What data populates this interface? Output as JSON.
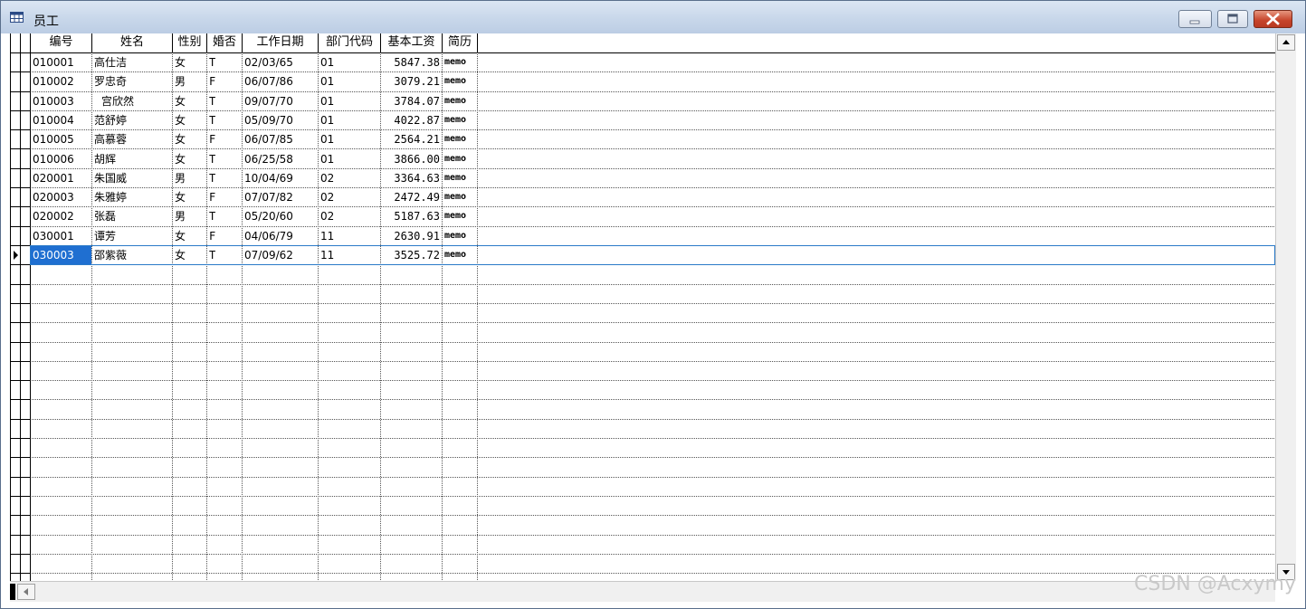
{
  "window": {
    "title": "员工",
    "title_icon": "table-icon",
    "controls": [
      "minimize-icon",
      "maximize-icon",
      "close-icon"
    ]
  },
  "table": {
    "columns": [
      "编号",
      "姓名",
      "性别",
      "婚否",
      "工作日期",
      "部门代码",
      "基本工资",
      "简历"
    ],
    "rows": [
      [
        "010001",
        "高仕洁",
        "女",
        "T",
        "02/03/65",
        "01",
        "5847.38",
        "memo"
      ],
      [
        "010002",
        "罗忠奇",
        "男",
        "F",
        "06/07/86",
        "01",
        "3079.21",
        "memo"
      ],
      [
        "010003",
        "宫欣然",
        "女",
        "T",
        "09/07/70",
        "01",
        "3784.07",
        "memo"
      ],
      [
        "010004",
        "范舒婷",
        "女",
        "T",
        "05/09/70",
        "01",
        "4022.87",
        "memo"
      ],
      [
        "010005",
        "高慕蓉",
        "女",
        "F",
        "06/07/85",
        "01",
        "2564.21",
        "memo"
      ],
      [
        "010006",
        "胡辉",
        "女",
        "T",
        "06/25/58",
        "01",
        "3866.00",
        "memo"
      ],
      [
        "020001",
        "朱国威",
        "男",
        "T",
        "10/04/69",
        "02",
        "3364.63",
        "memo"
      ],
      [
        "020003",
        "朱雅婷",
        "女",
        "F",
        "07/07/82",
        "02",
        "2472.49",
        "memo"
      ],
      [
        "020002",
        "张磊",
        "男",
        "T",
        "05/20/60",
        "02",
        "5187.63",
        "memo"
      ],
      [
        "030001",
        "谭芳",
        "女",
        "F",
        "04/06/79",
        "11",
        "2630.91",
        "memo"
      ],
      [
        "030003",
        "邵紫薇",
        "女",
        "T",
        "07/09/62",
        "11",
        "3525.72",
        "memo"
      ]
    ],
    "selected_row": 10,
    "selection_color": "#1f6fd1",
    "current_row_icon": "row-pointer-icon"
  },
  "scrollbars": {
    "vertical_up_icon": "scroll-up-icon",
    "vertical_down_icon": "scroll-down-icon",
    "horizontal_left_icon": "scroll-left-icon"
  },
  "watermark": "CSDN @Acxymy"
}
